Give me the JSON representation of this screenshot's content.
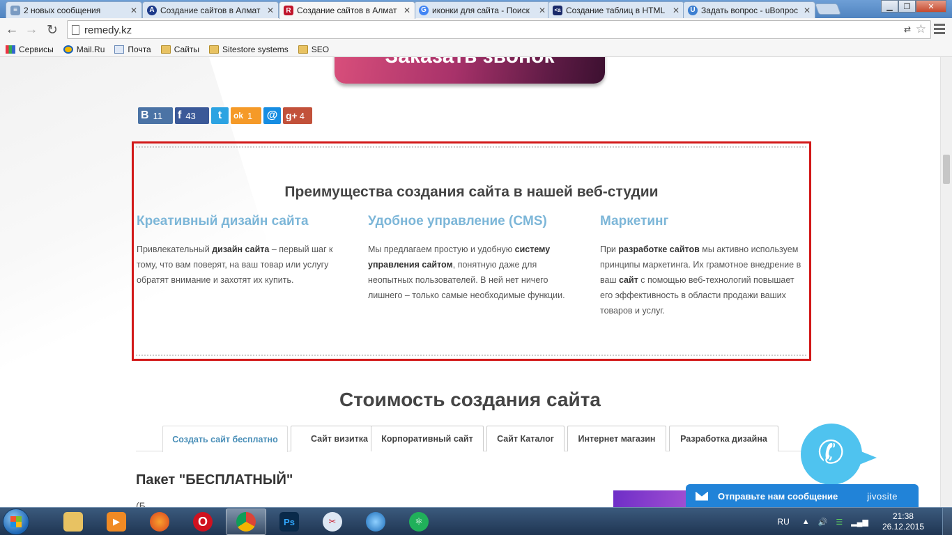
{
  "browser": {
    "tabs": [
      {
        "title": "2 новых сообщения",
        "icon": "mail-ru-icon",
        "color": "#7a9bc2",
        "glyph": "≡"
      },
      {
        "title": "Создание сайтов в Алмат",
        "icon": "site-a-icon",
        "color": "#1d3a8a",
        "glyph": "A"
      },
      {
        "title": "Создание сайтов в Алмат",
        "icon": "remedy-r-icon",
        "color": "#c0142a",
        "glyph": "R"
      },
      {
        "title": "иконки для сайта - Поиск",
        "icon": "google-icon",
        "color": "#4285f4",
        "glyph": "G"
      },
      {
        "title": "Создание таблиц в HTML",
        "icon": "htmlbook-icon",
        "color": "#1a2a6a",
        "glyph": "<a"
      },
      {
        "title": "Задать вопрос - uВопрос",
        "icon": "uvopros-icon",
        "color": "#3d7fd1",
        "glyph": "U"
      }
    ],
    "url": "remedy.kz",
    "bookmarks": [
      {
        "label": "Сервисы",
        "icon": "apps-grid-icon"
      },
      {
        "label": "Mail.Ru",
        "icon": "mailru-at-icon"
      },
      {
        "label": "Почта",
        "icon": "envelope-icon"
      },
      {
        "label": "Сайты",
        "icon": "folder-icon"
      },
      {
        "label": "Sitestore systems",
        "icon": "folder-icon"
      },
      {
        "label": "SEO",
        "icon": "folder-icon"
      }
    ]
  },
  "page": {
    "callback_button": "Заказать звонок",
    "share": {
      "vk": {
        "glyph": "B",
        "count": "11"
      },
      "fb": {
        "glyph": "f",
        "count": "43"
      },
      "tw": {
        "glyph": "t"
      },
      "ok": {
        "glyph": "ok",
        "count": "1"
      },
      "mr": {
        "glyph": "@"
      },
      "gp": {
        "glyph": "g+",
        "count": "4"
      }
    },
    "advantages": {
      "title": "Преимущества создания сайта в нашей веб-студии",
      "columns": [
        {
          "heading": "Креативный дизайн сайта",
          "t1": "Привлекательный ",
          "b1": "дизайн сайта",
          "t2": " – первый шаг к тому, что вам поверят, на ваш товар или услугу обратят внимание и захотят их купить."
        },
        {
          "heading": "Удобное управление (CMS)",
          "t1": "Мы предлагаем простую и удобную ",
          "b1": "систему управления сайтом",
          "t2": ", понятную даже для неопытных пользователей. В ней нет ничего лишнего – только самые необходимые функции."
        },
        {
          "heading": "Маркетинг",
          "t1": "При ",
          "b1": "разработке сайтов",
          "t2": " мы активно используем принципы маркетинга. Их грамотное внедрение в ваш ",
          "b2": "сайт",
          "t3": " с помощью веб-технологий повышает его эффективность в области продажи ваших товаров и услуг."
        }
      ]
    },
    "pricing": {
      "title": "Стоимость создания сайта",
      "tabs": [
        "Создать сайт бесплатно",
        "Сайт визитка",
        "Корпоративный сайт",
        "Сайт Каталог",
        "Интернет магазин",
        "Разработка дизайна"
      ],
      "active_tab": 0,
      "package_title": "Пакет \"БЕСПЛАТНЫЙ\"",
      "package_sub": "(Б"
    },
    "jivosite": {
      "label": "Отправьте нам сообщение",
      "brand": "jivosite"
    },
    "accent_color": "#7cb6d8",
    "highlight_border": "#d21818"
  },
  "taskbar": {
    "apps": [
      "explorer",
      "media-player",
      "firefox",
      "opera",
      "chrome",
      "photoshop",
      "paint-tool",
      "network-browser",
      "atom-app"
    ],
    "lang": "RU",
    "time": "21:38",
    "date": "26.12.2015"
  }
}
